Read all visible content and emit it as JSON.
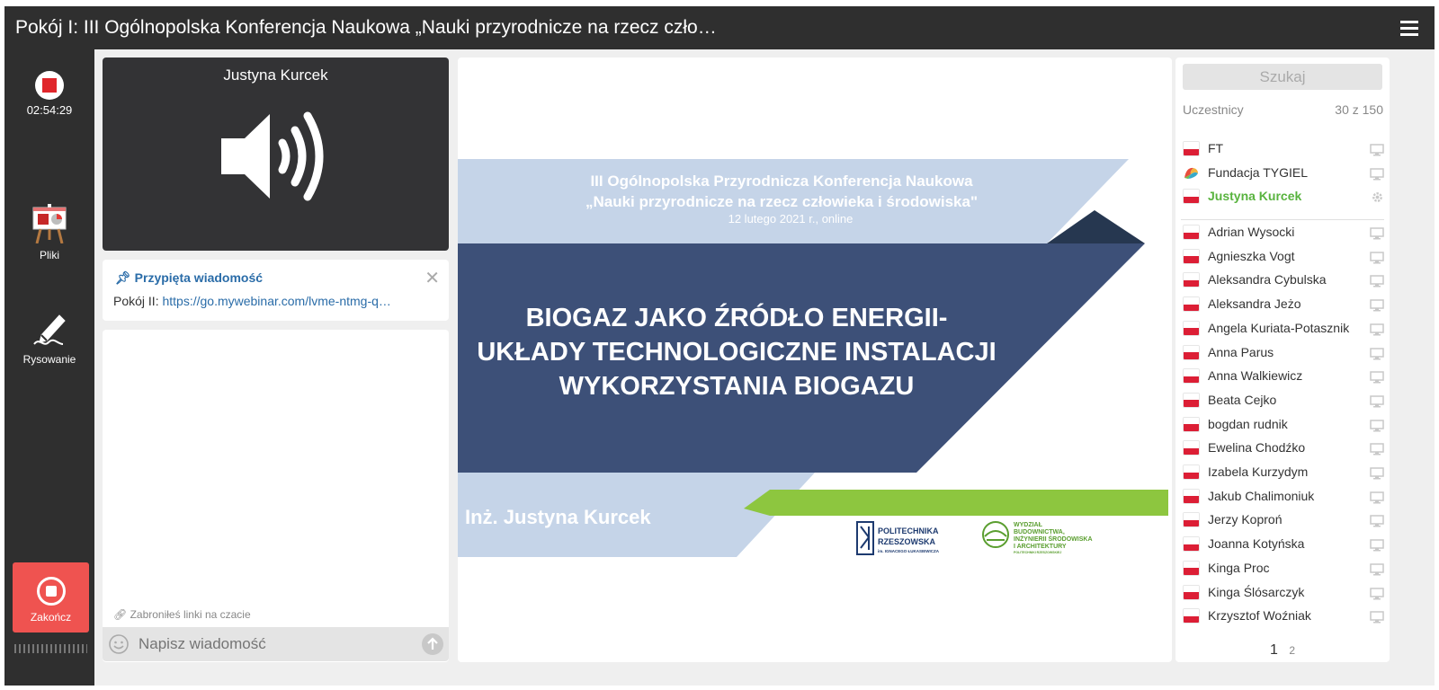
{
  "window": {
    "title": "Pokój I: III Ogólnopolska Konferencja Naukowa „Nauki przyrodnicze na rzecz czło…"
  },
  "leftbar": {
    "recording_time": "02:54:29",
    "files_label": "Pliki",
    "drawing_label": "Rysowanie",
    "end_label": "Zakończ"
  },
  "speaker": {
    "name": "Justyna Kurcek"
  },
  "pinned": {
    "header": "Przypięta wiadomość",
    "prefix": "Pokój II:",
    "link": "https://go.mywebinar.com/lvme-ntmg-q…"
  },
  "chat": {
    "note": "Zabroniłeś linki na czacie",
    "placeholder": "Napisz wiadomość"
  },
  "slide": {
    "conference_line1": "III Ogólnopolska Przyrodnicza Konferencja Naukowa",
    "conference_line2": "„Nauki przyrodnicze na rzecz człowieka i środowiska\"",
    "date": "12 lutego 2021 r., online",
    "title_line1": "BIOGAZ JAKO ŹRÓDŁO ENERGII-",
    "title_line2": "UKŁADY TECHNOLOGICZNE INSTALACJI",
    "title_line3": "WYKORZYSTANIA BIOGAZU",
    "author": "Inż. Justyna Kurcek",
    "logo1_line1": "POLITECHNIKA",
    "logo1_line2": "RZESZOWSKA",
    "logo1_line3": "im. IGNACEGO ŁUKASIEWICZA",
    "logo2_line1": "WYDZIAŁ",
    "logo2_line2": "BUDOWNICTWA,",
    "logo2_line3": "INŻYNIERII ŚRODOWISKA",
    "logo2_line4": "I ARCHITEKTURY",
    "logo2_line5": "POLITECHNIKI RZESZOWSKIEJ"
  },
  "participants": {
    "search_label": "Szukaj",
    "label": "Uczestnicy",
    "count": "30 z 150",
    "hosts": [
      {
        "name": "FT",
        "icon": "flag-pl",
        "device": "monitor-icon"
      },
      {
        "name": "Fundacja TYGIEL",
        "icon": "tygiel-logo",
        "device": "monitor-icon"
      },
      {
        "name": "Justyna Kurcek",
        "icon": "flag-pl",
        "device": "gear-icon",
        "active": true
      }
    ],
    "list": [
      "Adrian Wysocki",
      "Agnieszka Vogt",
      "Aleksandra Cybulska",
      "Aleksandra Jeżo",
      "Angela Kuriata-Potasznik",
      "Anna Parus",
      "Anna Walkiewicz",
      "Beata Cejko",
      "bogdan rudnik",
      "Ewelina Chodźko",
      "Izabela Kurzydym",
      "Jakub Chalimoniuk",
      "Jerzy Koproń",
      "Joanna Kotyńska",
      "Kinga Proc",
      "Kinga Ślósarczyk",
      "Krzysztof Woźniak"
    ],
    "page_current": "1",
    "page_next": "2"
  },
  "colors": {
    "topbar": "#2f2f2f",
    "slide_light_blue": "#c5d4e8",
    "slide_dark_blue": "#3d5078",
    "slide_navy": "#263750",
    "slide_green": "#8dc63f",
    "end_button": "#ef5350",
    "active_participant": "#58b33e",
    "link": "#2a6ca8"
  }
}
